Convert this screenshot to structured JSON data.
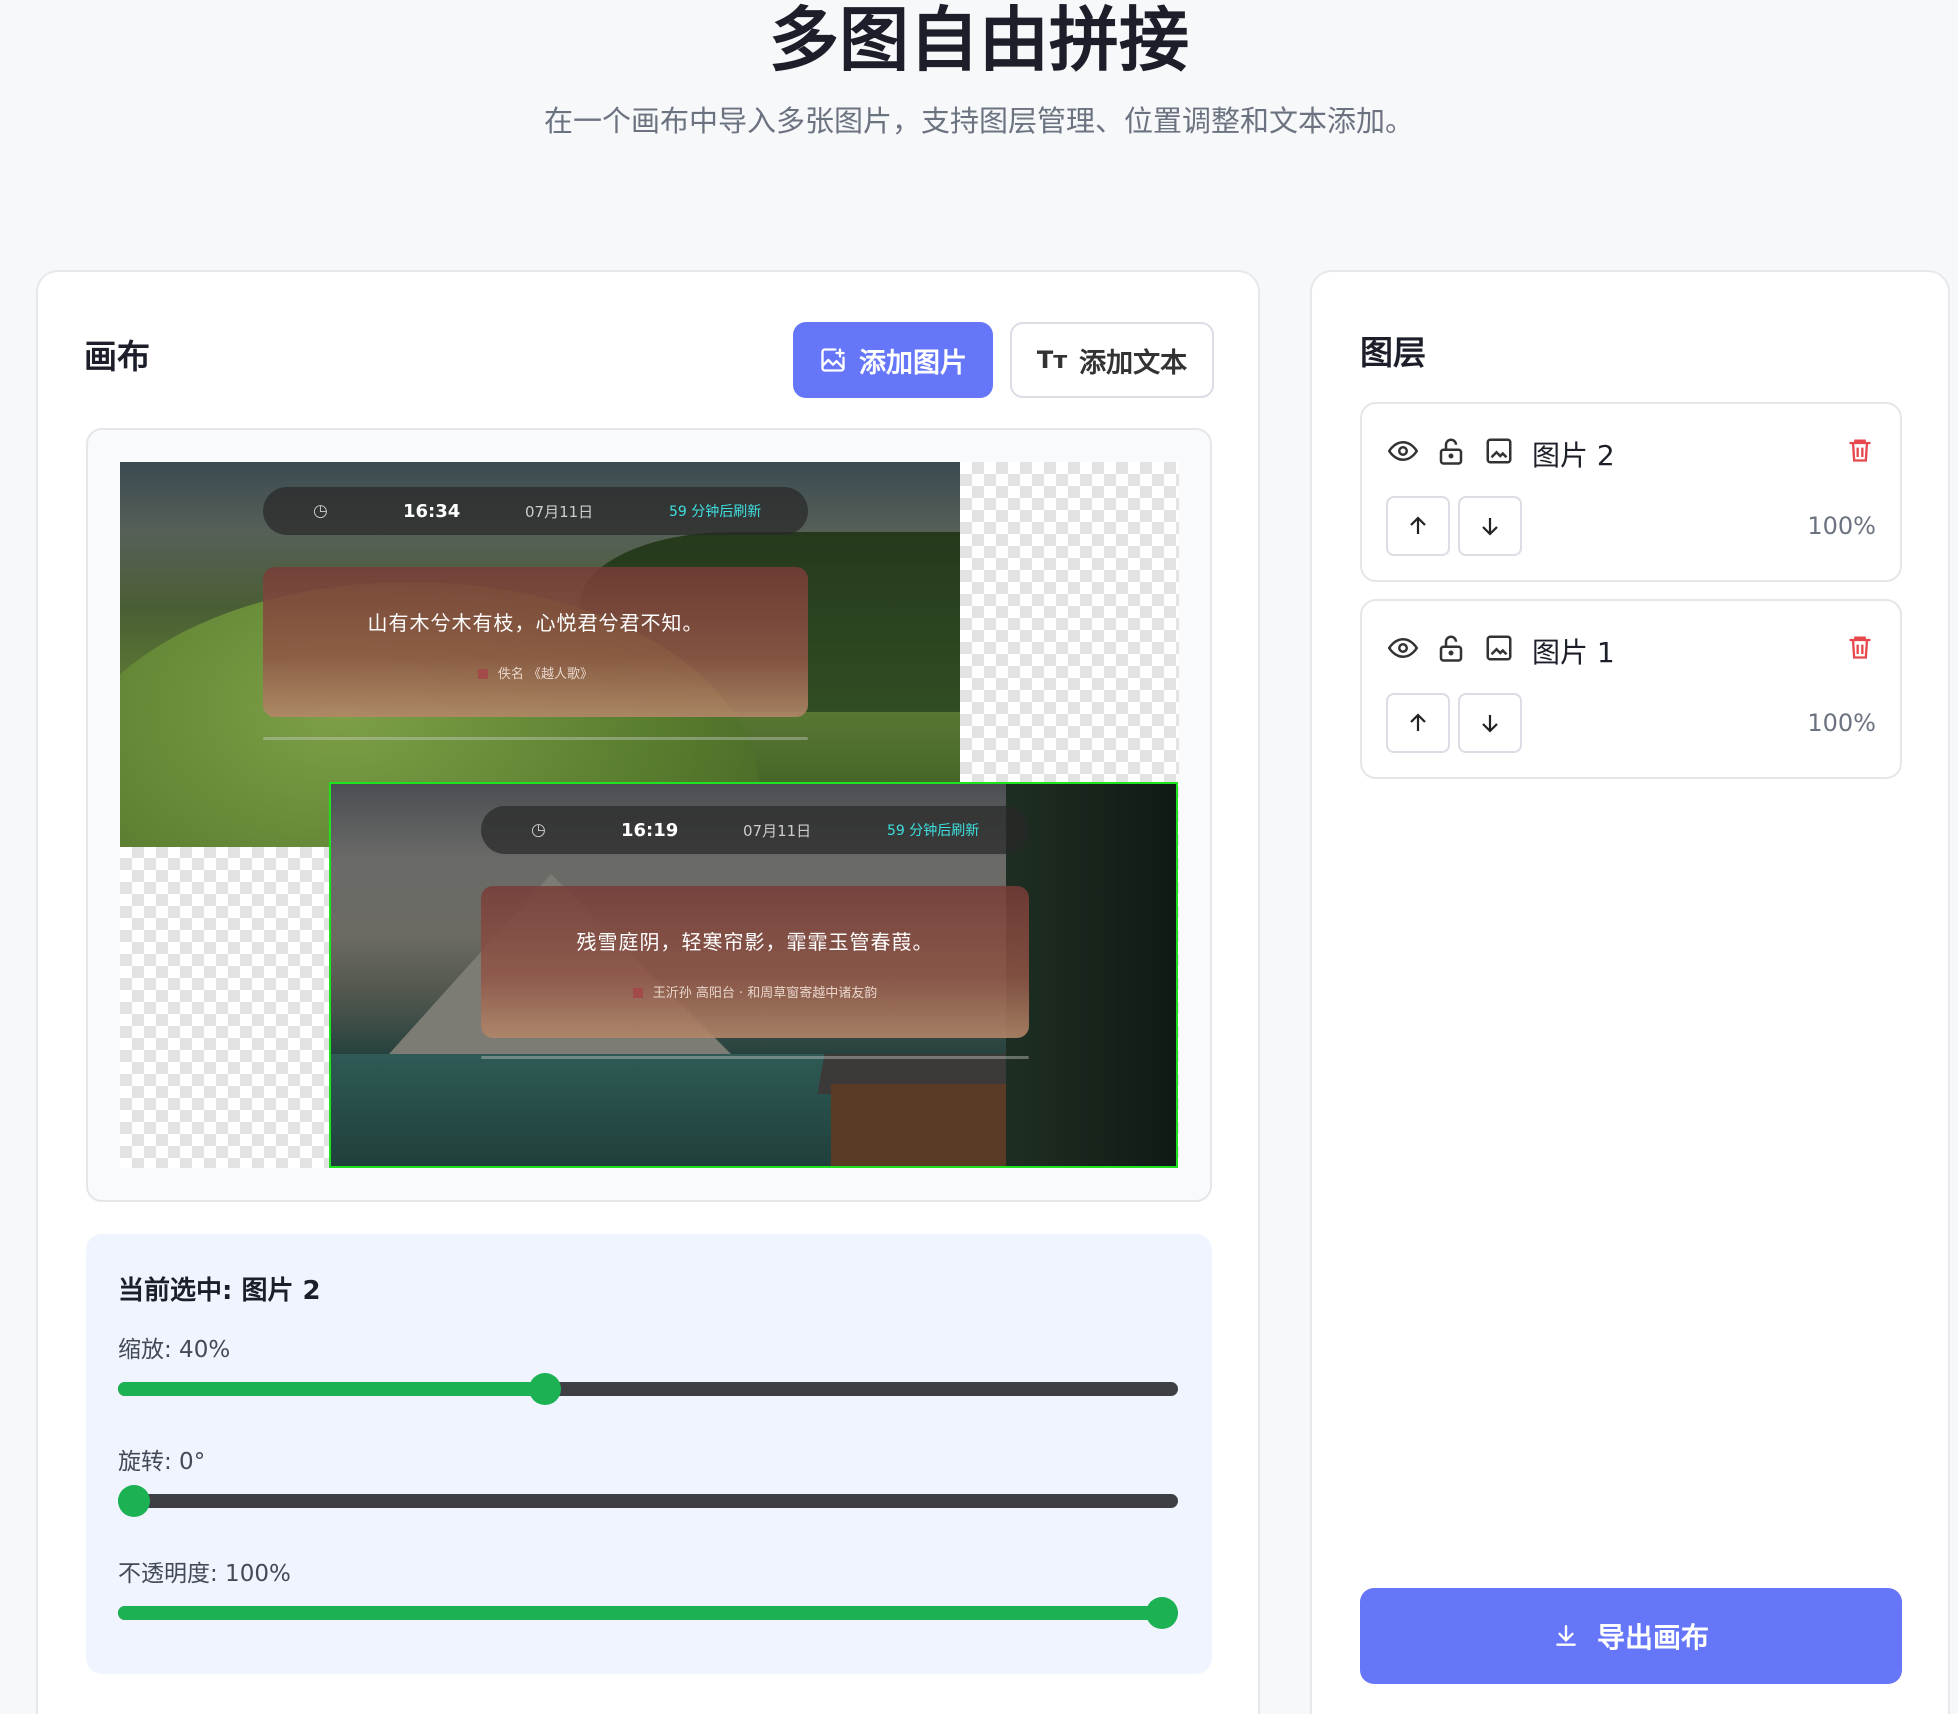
{
  "header": {
    "title": "多图自由拼接",
    "subtitle": "在一个画布中导入多张图片，支持图层管理、位置调整和文本添加。"
  },
  "canvas_panel": {
    "title": "画布",
    "add_image_label": "添加图片",
    "add_text_label": "添加文本",
    "add_text_icon": "Tт"
  },
  "canvas": {
    "image1": {
      "time": "16:34",
      "date": "07月11日",
      "refresh": "59 分钟后刷新",
      "quote": "山有木兮木有枝，心悦君兮君不知。",
      "source": "佚名 《越人歌》"
    },
    "image2": {
      "time": "16:19",
      "date": "07月11日",
      "refresh": "59 分钟后刷新",
      "quote": "残雪庭阴，轻寒帘影，霏霏玉管春葭。",
      "source": "王沂孙  高阳台 · 和周草窗寄越中诸友韵"
    }
  },
  "controls": {
    "selected_title": "当前选中: 图片 2",
    "scale_label": "缩放: 40%",
    "scale_value": 0.4,
    "rotation_label": "旋转: 0°",
    "rotation_value": 0,
    "opacity_label": "不透明度: 100%",
    "opacity_value": 1.0
  },
  "layers_panel": {
    "title": "图层",
    "layers": [
      {
        "name": "图片 2",
        "opacity": "100%"
      },
      {
        "name": "图片 1",
        "opacity": "100%"
      }
    ],
    "export_label": "导出画布"
  },
  "icons": {
    "visibility": "eye-icon",
    "lock": "unlock-icon",
    "type": "image-icon",
    "delete": "trash-icon",
    "up": "arrow-up-icon",
    "down": "arrow-down-icon",
    "export": "download-icon"
  },
  "colors": {
    "primary": "#6576f8",
    "slider_fill": "#1cb253",
    "delete": "#e5484d",
    "selection_border": "#1ee31e"
  }
}
